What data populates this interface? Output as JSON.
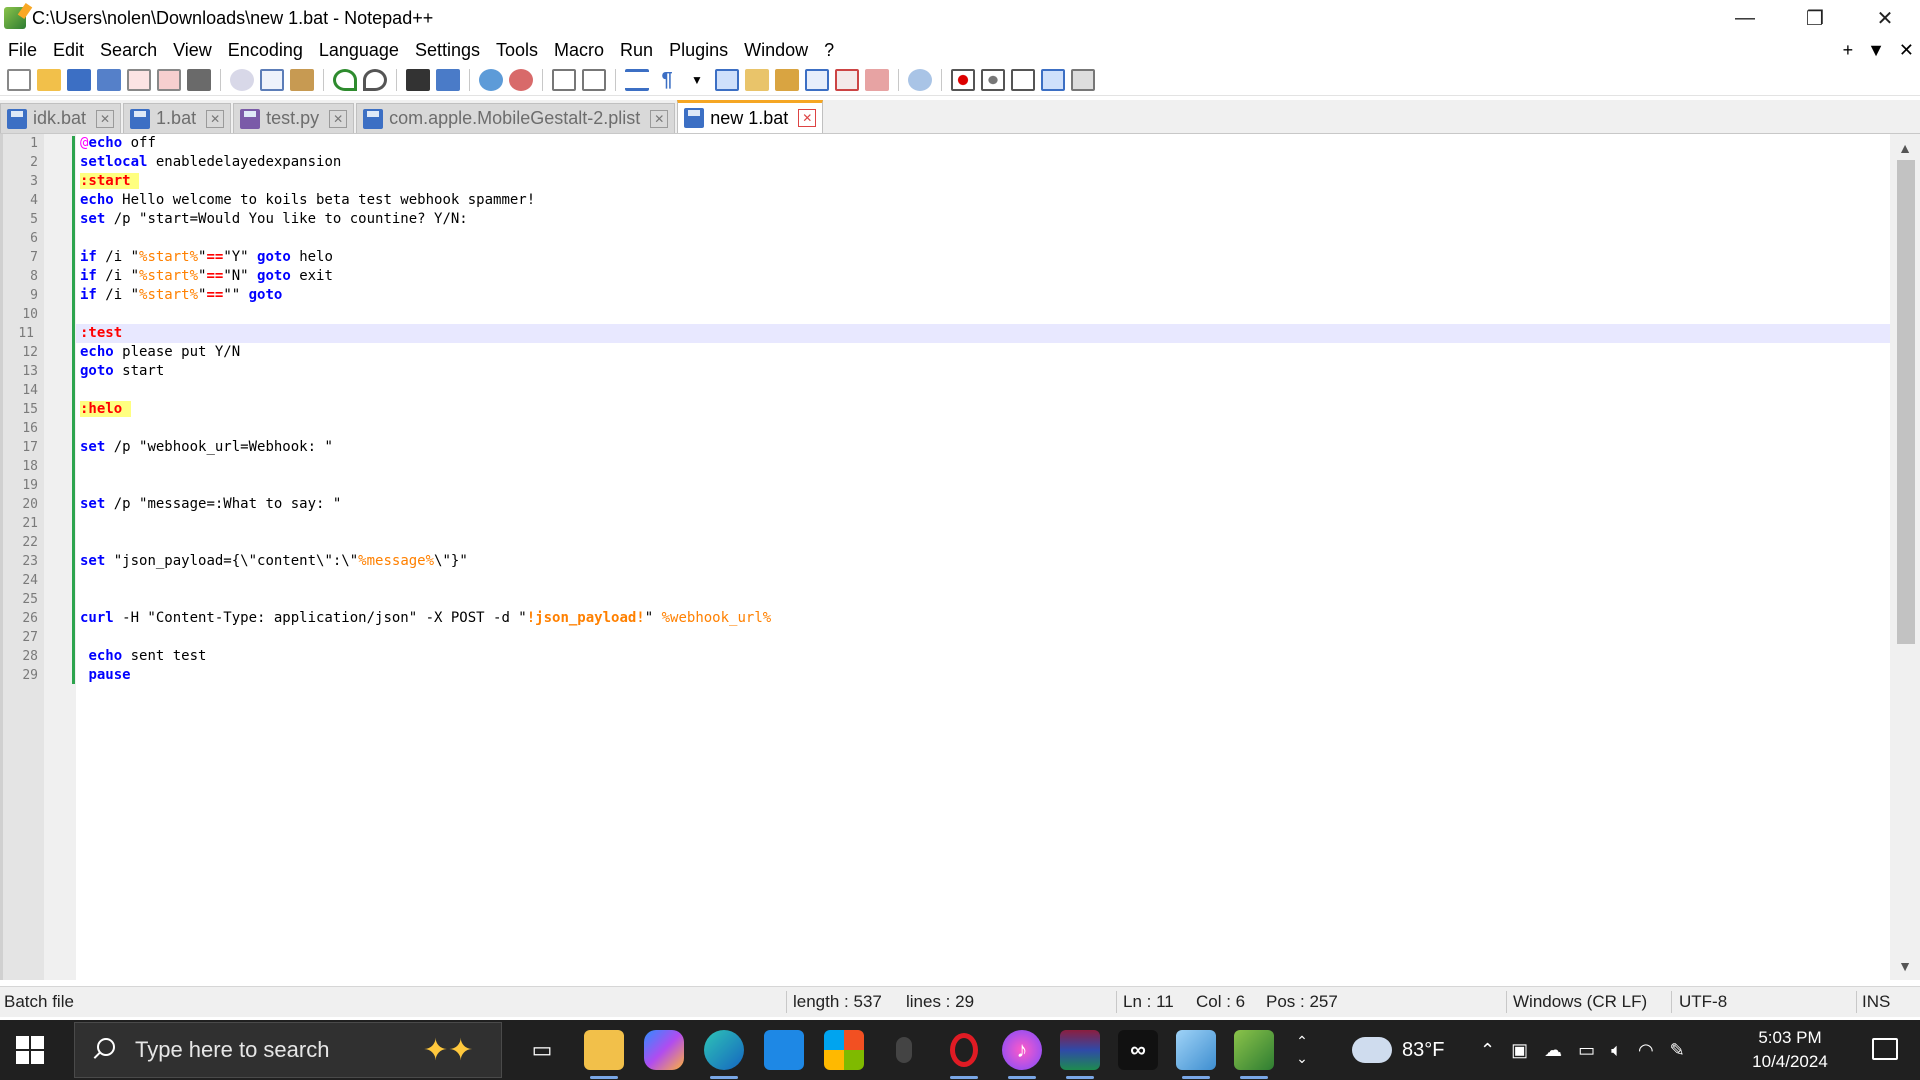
{
  "window": {
    "title": "C:\\Users\\nolen\\Downloads\\new 1.bat - Notepad++",
    "minimize": "—",
    "restore": "❐",
    "close": "✕"
  },
  "menu": {
    "items": [
      "File",
      "Edit",
      "Search",
      "View",
      "Encoding",
      "Language",
      "Settings",
      "Tools",
      "Macro",
      "Run",
      "Plugins",
      "Window",
      "?"
    ],
    "right": {
      "new_tab": "+",
      "list": "▼",
      "close": "✕"
    }
  },
  "tabs": [
    {
      "label": "idk.bat",
      "icon": "disk-icon",
      "active": false
    },
    {
      "label": "1.bat",
      "icon": "disk-icon",
      "active": false
    },
    {
      "label": "test.py",
      "icon": "disk-icon",
      "active": false
    },
    {
      "label": "com.apple.MobileGestalt-2.plist",
      "icon": "disk-icon",
      "active": false
    },
    {
      "label": "new 1.bat",
      "icon": "disk-icon",
      "active": true
    }
  ],
  "editor": {
    "current_line": 11,
    "lines": [
      "@echo off",
      "setlocal enabledelayedexpansion",
      ":start",
      "echo Hello welcome to koils beta test webhook spammer!",
      "set /p \"start=Would You like to countine? Y/N:",
      "",
      "if /i \"%start%\"==\"Y\" goto helo",
      "if /i \"%start%\"==\"N\" goto exit",
      "if /i \"%start%\"==\"\" goto",
      "",
      ":test",
      "echo please put Y/N",
      "goto start",
      "",
      ":helo",
      "",
      "set /p \"webhook_url=Webhook: \"",
      "",
      "",
      "set /p \"message=:What to say: \"",
      "",
      "",
      "set \"json_payload={\\\"content\\\":\\\"%message%\\\"}\"",
      "",
      "",
      "curl -H \"Content-Type: application/json\" -X POST -d \"!json_payload!\" %webhook_url%",
      "",
      " echo sent test",
      " pause"
    ]
  },
  "status": {
    "lang": "Batch file",
    "length": "length : 537",
    "lines": "lines : 29",
    "ln": "Ln : 11",
    "col": "Col : 6",
    "pos": "Pos : 257",
    "eol": "Windows (CR LF)",
    "encoding": "UTF-8",
    "mode": "INS"
  },
  "taskbar": {
    "search_placeholder": "Type here to search",
    "weather_temp": "83°F",
    "time": "5:03 PM",
    "date": "10/4/2024",
    "apps": [
      "task-view-icon",
      "file-explorer-icon",
      "copilot-icon",
      "edge-icon",
      "mail-icon",
      "store-icon",
      "mouse-icon",
      "opera-icon",
      "itunes-icon",
      "winrar-icon",
      "meta-icon",
      "app-icon",
      "notepadpp-icon"
    ]
  },
  "colors": {
    "keyword": "#0000ff",
    "label": "#ff0000",
    "label_bg": "#ffff80",
    "variable": "#ff8000",
    "echo_at": "#ff00ff",
    "current_line_bg": "#e8e8ff",
    "tab_accent": "#f5a623",
    "fold_line": "#2da44e"
  }
}
